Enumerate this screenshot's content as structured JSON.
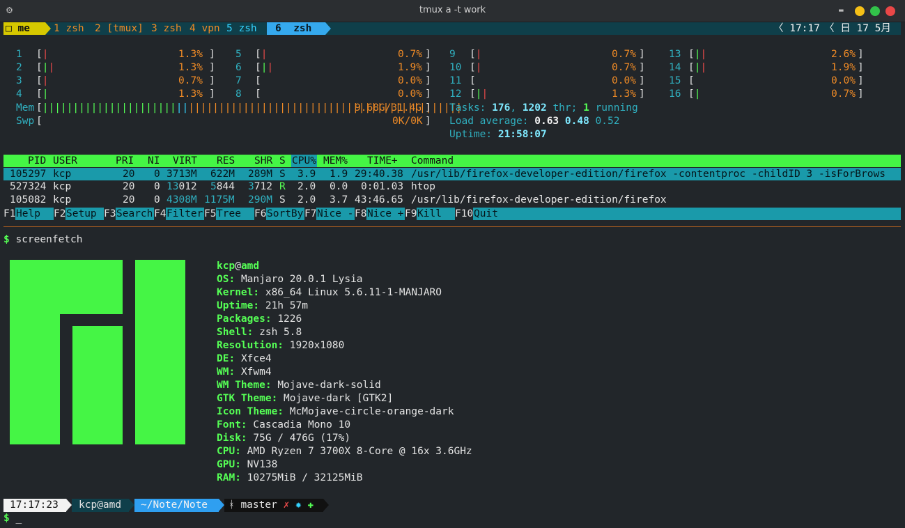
{
  "window": {
    "title": "tmux a -t work"
  },
  "tmux": {
    "session": "□ me",
    "windows": [
      {
        "index": "1",
        "name": "zsh"
      },
      {
        "index": "2",
        "name": "[tmux]"
      },
      {
        "index": "3",
        "name": "zsh"
      },
      {
        "index": "4",
        "name": "vpn"
      },
      {
        "index": "5",
        "name": "zsh"
      }
    ],
    "active_window": {
      "index": "6",
      "name": "zsh"
    },
    "time": "17:17",
    "date": "日 17 5月"
  },
  "htop": {
    "cpus": [
      {
        "id": "1",
        "value": "1.3%"
      },
      {
        "id": "2",
        "value": "1.3%"
      },
      {
        "id": "3",
        "value": "0.7%"
      },
      {
        "id": "4",
        "value": "1.3%"
      },
      {
        "id": "5",
        "value": "0.7%"
      },
      {
        "id": "6",
        "value": "1.9%"
      },
      {
        "id": "7",
        "value": "0.0%"
      },
      {
        "id": "8",
        "value": "0.0%"
      },
      {
        "id": "9",
        "value": "0.7%"
      },
      {
        "id": "10",
        "value": "0.7%"
      },
      {
        "id": "11",
        "value": "0.0%"
      },
      {
        "id": "12",
        "value": "1.3%"
      },
      {
        "id": "13",
        "value": "2.6%"
      },
      {
        "id": "14",
        "value": "1.9%"
      },
      {
        "id": "15",
        "value": "0.0%"
      },
      {
        "id": "16",
        "value": "0.7%"
      }
    ],
    "mem": {
      "label": "Mem",
      "value": "9.68G/31.4G"
    },
    "swp": {
      "label": "Swp",
      "value": "0K/0K"
    },
    "tasks": {
      "label": "Tasks:",
      "tasks": "176",
      "comma": ",",
      "threads": "1202",
      "thr": "thr;",
      "running": "1",
      "running_label": "running"
    },
    "load": {
      "label": "Load average:",
      "l1": "0.63",
      "l5": "0.48",
      "l15": "0.52"
    },
    "uptime": {
      "label": "Uptime:",
      "value": "21:58:07"
    },
    "columns": {
      "pid": "PID",
      "user": "USER",
      "pri": "PRI",
      "ni": "NI",
      "virt": "VIRT",
      "res": "RES",
      "shr": "SHR",
      "s": "S",
      "cpu": "CPU%",
      "mem": "MEM%",
      "time": "TIME+",
      "command": "Command"
    },
    "processes": [
      {
        "pid": "105297",
        "user": "kcp",
        "pri": "20",
        "ni": "0",
        "virt": "3713M",
        "res": "622M",
        "shr": "289M",
        "s": "S",
        "cpu": "3.9",
        "mem": "1.9",
        "time": "29:40.38",
        "command": "/usr/lib/firefox-developer-edition/firefox -contentproc -childID 3 -isForBrows"
      },
      {
        "pid": "527324",
        "user": "kcp",
        "pri": "20",
        "ni": "0",
        "virt_a": "13",
        "virt_b": "012",
        "res_a": "5",
        "res_b": "844",
        "shr_a": "3",
        "shr_b": "712",
        "s": "R",
        "cpu": "2.0",
        "mem": "0.0",
        "time": "0:01.03",
        "command": "htop"
      },
      {
        "pid": "105082",
        "user": "kcp",
        "pri": "20",
        "ni": "0",
        "virt": "4308M",
        "res": "1175M",
        "shr": "290M",
        "s": "S",
        "cpu": "2.0",
        "mem": "3.7",
        "time": "43:46.65",
        "command": "/usr/lib/firefox-developer-edition/firefox"
      }
    ],
    "fkeys": [
      {
        "key": "F1",
        "label": "Help"
      },
      {
        "key": "F2",
        "label": "Setup"
      },
      {
        "key": "F3",
        "label": "Search"
      },
      {
        "key": "F4",
        "label": "Filter"
      },
      {
        "key": "F5",
        "label": "Tree"
      },
      {
        "key": "F6",
        "label": "SortBy"
      },
      {
        "key": "F7",
        "label": "Nice -"
      },
      {
        "key": "F8",
        "label": "Nice +"
      },
      {
        "key": "F9",
        "label": "Kill"
      },
      {
        "key": "F10",
        "label": "Quit"
      }
    ]
  },
  "shell": {
    "ps1": "$",
    "command": "screenfetch",
    "userhost": {
      "user": "kcp",
      "at": "@",
      "host": "amd"
    },
    "info": [
      {
        "key": "OS:",
        "value": "Manjaro 20.0.1 Lysia"
      },
      {
        "key": "Kernel:",
        "value": "x86_64 Linux 5.6.11-1-MANJARO"
      },
      {
        "key": "Uptime:",
        "value": "21h 57m"
      },
      {
        "key": "Packages:",
        "value": "1226"
      },
      {
        "key": "Shell:",
        "value": "zsh 5.8"
      },
      {
        "key": "Resolution:",
        "value": "1920x1080"
      },
      {
        "key": "DE:",
        "value": "Xfce4"
      },
      {
        "key": "WM:",
        "value": "Xfwm4"
      },
      {
        "key": "WM Theme:",
        "value": "Mojave-dark-solid"
      },
      {
        "key": "GTK Theme:",
        "value": "Mojave-dark [GTK2]"
      },
      {
        "key": "Icon Theme:",
        "value": "McMojave-circle-orange-dark"
      },
      {
        "key": "Font:",
        "value": "Cascadia Mono 10"
      },
      {
        "key": "Disk:",
        "value": "75G / 476G (17%)"
      },
      {
        "key": "CPU:",
        "value": "AMD Ryzen 7 3700X 8-Core @ 16x 3.6GHz"
      },
      {
        "key": "GPU:",
        "value": "NV138"
      },
      {
        "key": "RAM:",
        "value": "10275MiB / 32125MiB"
      }
    ],
    "prompt": {
      "time": "17:17:23",
      "userhost": "kcp@amd",
      "path": "~/Note/Note",
      "branch_icon": "ᚼ",
      "branch": "master",
      "status_x": "✗",
      "status_star": "✹",
      "status_plus": "✚"
    },
    "cursor": "_"
  },
  "colors": {
    "background": "#22262a",
    "green": "#55ff55",
    "cyan": "#35d3ff",
    "orange": "#ee8a26",
    "red": "#e84a4a",
    "teal_bar": "#1a9aaa"
  }
}
